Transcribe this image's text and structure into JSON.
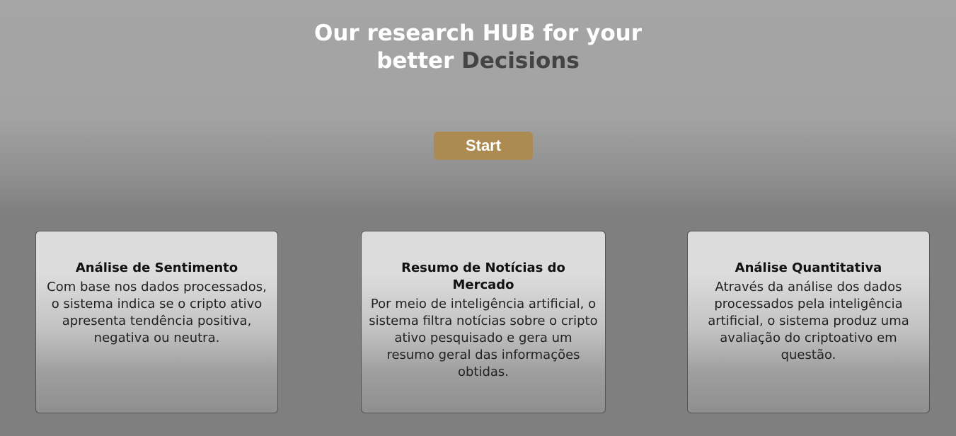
{
  "hero": {
    "title_line1": "Our research HUB for your",
    "title_line2_prefix": "better ",
    "title_line2_accent": "Decisions"
  },
  "start_button": {
    "label": "Start"
  },
  "cards": [
    {
      "title": "Análise de Sentimento",
      "text": "Com base nos dados processados, o sistema indica se o cripto ativo apresenta tendência positiva, negativa ou neutra."
    },
    {
      "title": "Resumo de Notícias do Mercado",
      "text": "Por meio de inteligência artificial, o sistema filtra notícias sobre o cripto ativo pesquisado e gera um resumo geral das informações obtidas."
    },
    {
      "title": "Análise Quantitativa",
      "text": "Através da análise dos dados processados pela inteligência artificial, o sistema produz uma avaliação do criptoativo em questão."
    }
  ],
  "colors": {
    "accent_text": "#444444",
    "button_background": "#ab8b51",
    "title_text": "#ffffff"
  }
}
